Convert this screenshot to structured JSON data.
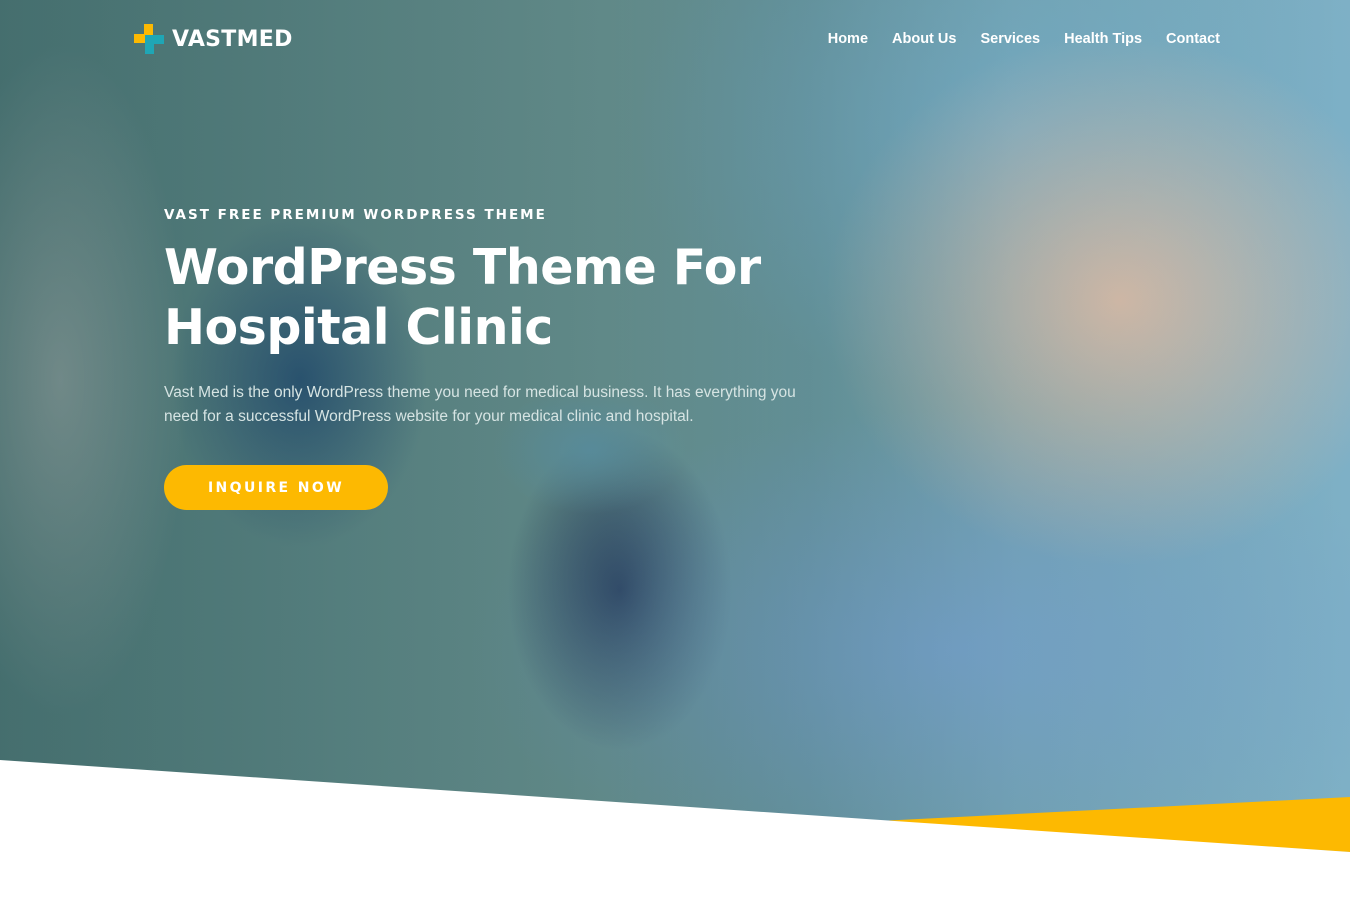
{
  "brand": {
    "name": "VASTMED",
    "accent_yellow": "#fdb901",
    "accent_teal": "#1fa6b5"
  },
  "nav": {
    "items": [
      {
        "label": "Home"
      },
      {
        "label": "About Us"
      },
      {
        "label": "Services"
      },
      {
        "label": "Health Tips"
      },
      {
        "label": "Contact"
      }
    ]
  },
  "hero": {
    "eyebrow": "VAST FREE PREMIUM WORDPRESS THEME",
    "headline": "WordPress Theme For Hospital Clinic",
    "lead": "Vast Med is the only WordPress theme you need for medical business. It has everything you need for a successful WordPress website for your medical clinic and hospital.",
    "cta_label": "INQUIRE NOW"
  }
}
